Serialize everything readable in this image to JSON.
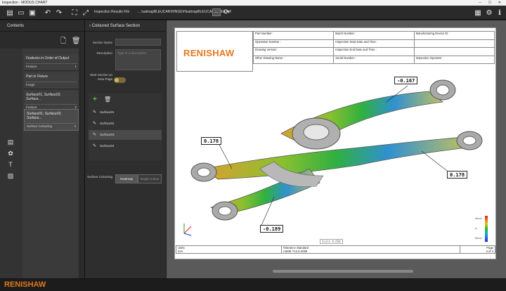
{
  "window": {
    "title": "Inspection - MODUS CHART"
  },
  "toolbar": {
    "results_label": "Inspection Results File",
    "results_file": "…\\satmapBLEUCAR\\HINGE\\HeatmapBLEUCAR\\HINGE.qif",
    "browse_label": "..."
  },
  "contents": {
    "header": "Contents",
    "items": [
      {
        "title": "Features in Order of Output",
        "sub": "Feature",
        "num": "1"
      },
      {
        "title": "Part in Fixture",
        "sub": "Image",
        "num": ""
      },
      {
        "title": "Surface01, Surface02, Surface...",
        "sub": "Feature",
        "num": "2"
      },
      {
        "title": "Surface01, Surface02, Surface...",
        "sub": "Surface Colouring",
        "num": "4"
      }
    ]
  },
  "section": {
    "header": "Coloured Surface Section",
    "name_label": "Section Name",
    "desc_label": "Description",
    "desc_placeholder": "Type in a description",
    "start_label": "Start Section on New Page",
    "surfaces": [
      "Surface01",
      "Surface02",
      "Surface03",
      "Surface04"
    ],
    "colouring_label": "Surface Colouring",
    "mode_heatmap": "Heatmap",
    "mode_single": "Single Colour"
  },
  "report": {
    "logo": "RENISHAW",
    "header_cells": [
      [
        "Part Number :",
        "Batch Number :",
        "Manufacturing Device ID :"
      ],
      [
        "Operation Number :",
        "Inspection Start Date and Time :",
        ""
      ],
      [
        "Drawing Version :",
        "Inspection End Date and Time :",
        ""
      ],
      [
        "Other Drawing Name :",
        "Serial Number :",
        "Inspection Operator :"
      ]
    ],
    "callouts": [
      "-0.167",
      "0.178",
      "0.178",
      "-0.189"
    ],
    "scale": "Scale 0.650",
    "legend": [
      "Above",
      "In",
      "Below"
    ],
    "footer": {
      "units_label": "Units",
      "units_value": "mm",
      "tol_label": "Tolerance Standard",
      "tol_value": "ASME Y14.5-2009",
      "page_label": "Page",
      "page_value": "4 of 4"
    }
  },
  "brand": {
    "name": "RENISHAW"
  },
  "colors": {
    "accent": "#e07a1f",
    "panel": "#2e2e2e",
    "page": "#ffffff"
  }
}
